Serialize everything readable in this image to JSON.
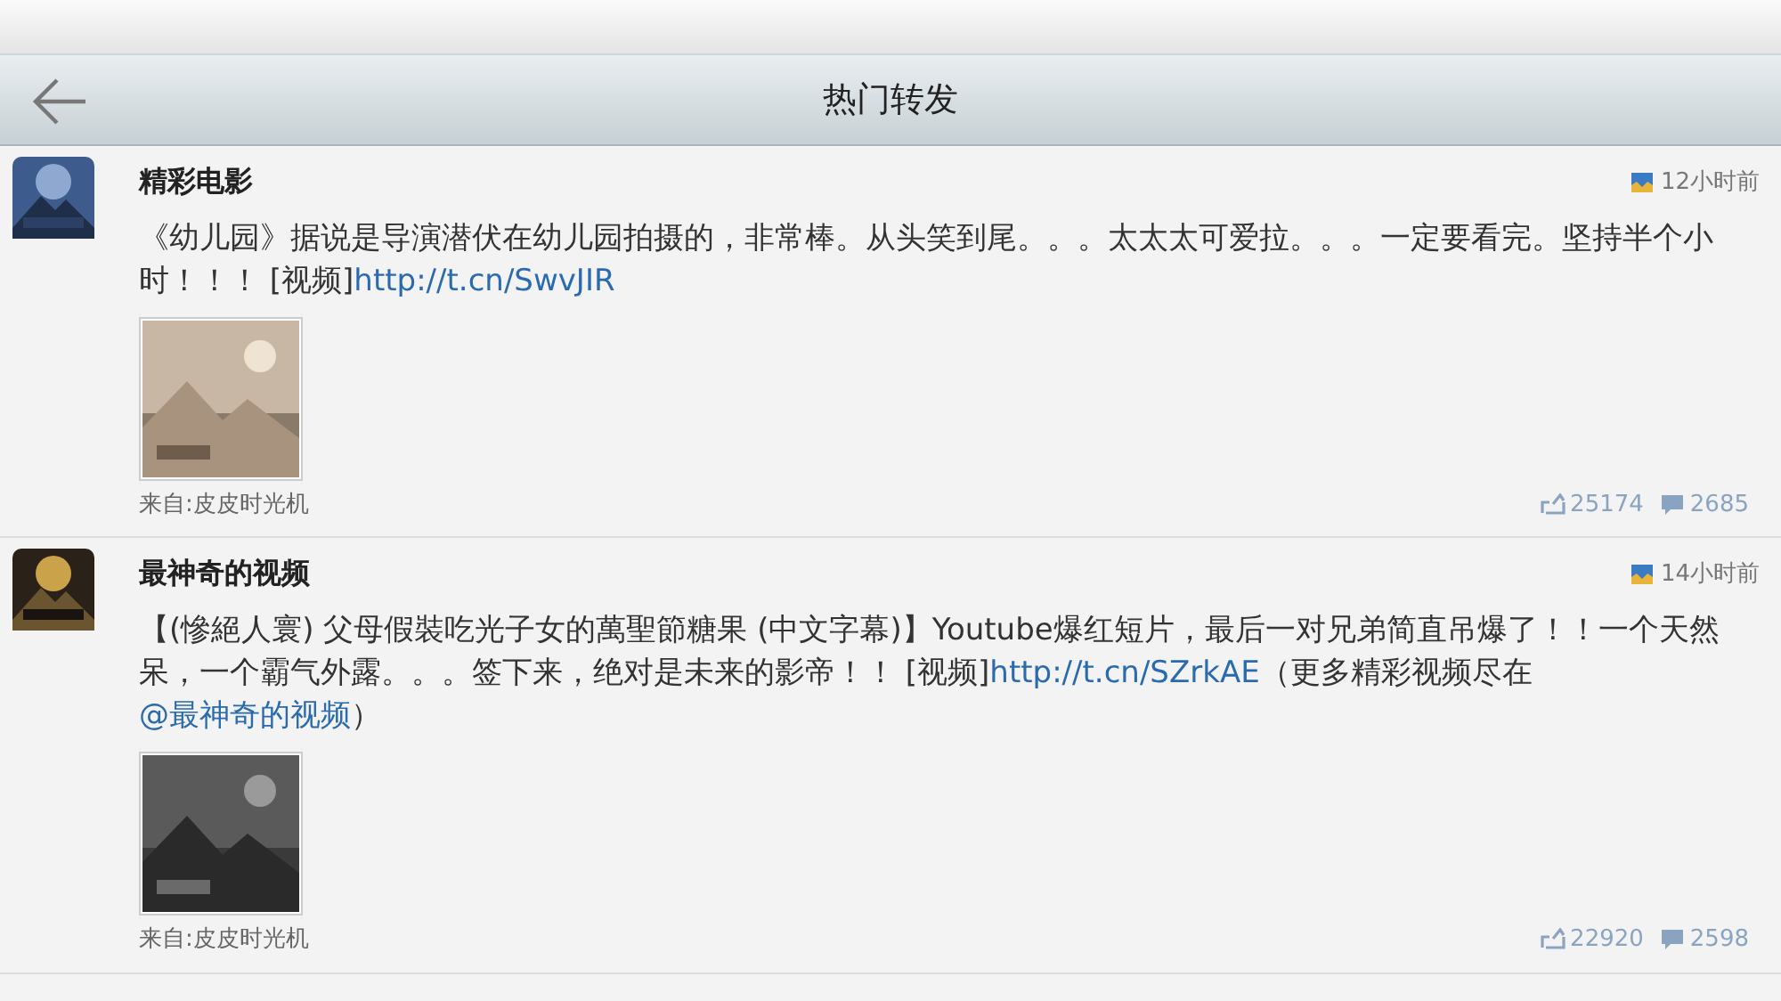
{
  "header": {
    "title": "热门转发"
  },
  "posts": [
    {
      "author": "精彩电影",
      "time": "12小时前",
      "body": [
        {
          "kind": "text",
          "text": "《幼儿园》据说是导演潜伏在幼儿园拍摄的，非常棒。从头笑到尾。。。太太太可爱拉。。。一定要看完。坚持半个小时！！！ [视频]"
        },
        {
          "kind": "link",
          "text": "http://t.cn/SwvJIR"
        }
      ],
      "source": "来自:皮皮时光机",
      "reposts": "25174",
      "comments": "2685"
    },
    {
      "author": "最神奇的视频",
      "time": "14小时前",
      "body": [
        {
          "kind": "text",
          "text": "【(慘絕人寰) 父母假裝吃光子女的萬聖節糖果 (中文字幕)】Youtube爆红短片，最后一对兄弟简直吊爆了！！一个天然呆，一个霸气外露。。。签下来，绝对是未来的影帝！！ [视频]"
        },
        {
          "kind": "link",
          "text": "http://t.cn/SZrkAE"
        },
        {
          "kind": "text",
          "text": "（更多精彩视频尽在"
        },
        {
          "kind": "link",
          "text": "@最神奇的视频"
        },
        {
          "kind": "text",
          "text": "）"
        }
      ],
      "source": "来自:皮皮时光机",
      "reposts": "22920",
      "comments": "2598"
    }
  ]
}
